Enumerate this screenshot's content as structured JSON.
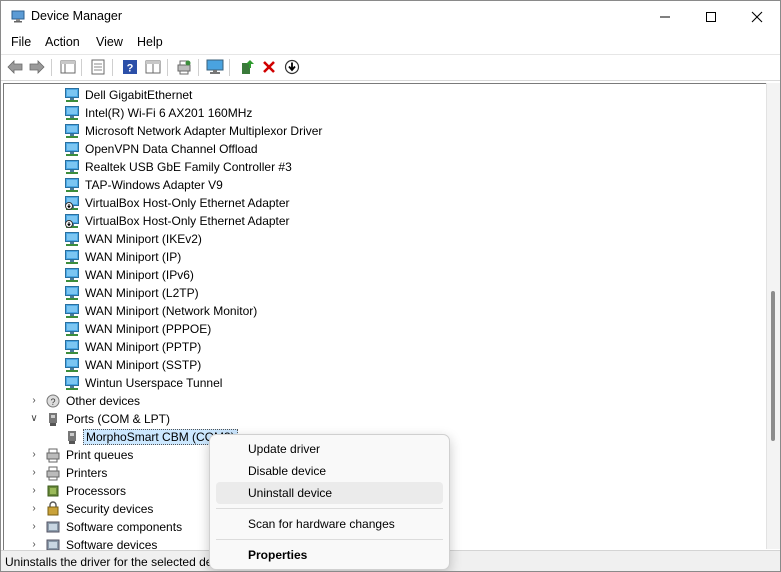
{
  "window": {
    "title": "Device Manager"
  },
  "menubar": {
    "file": "File",
    "action": "Action",
    "view": "View",
    "help": "Help"
  },
  "tree": {
    "network_adapters": [
      "Dell GigabitEthernet",
      "Intel(R) Wi-Fi 6 AX201 160MHz",
      "Microsoft Network Adapter Multiplexor Driver",
      "OpenVPN Data Channel Offload",
      "Realtek USB GbE Family Controller #3",
      "TAP-Windows Adapter V9",
      "VirtualBox Host-Only Ethernet Adapter",
      "VirtualBox Host-Only Ethernet Adapter",
      "WAN Miniport (IKEv2)",
      "WAN Miniport (IP)",
      "WAN Miniport (IPv6)",
      "WAN Miniport (L2TP)",
      "WAN Miniport (Network Monitor)",
      "WAN Miniport (PPPOE)",
      "WAN Miniport (PPTP)",
      "WAN Miniport (SSTP)",
      "Wintun Userspace Tunnel"
    ],
    "other_devices": "Other devices",
    "ports": "Ports (COM & LPT)",
    "ports_child": "MorphoSmart CBM (COM3)",
    "print_queues": "Print queues",
    "printers": "Printers",
    "processors": "Processors",
    "security_devices": "Security devices",
    "software_components": "Software components",
    "software_devices": "Software devices"
  },
  "context_menu": {
    "update_driver": "Update driver",
    "disable_device": "Disable device",
    "uninstall_device": "Uninstall device",
    "scan_hardware": "Scan for hardware changes",
    "properties": "Properties"
  },
  "statusbar": {
    "text": "Uninstalls the driver for the selected device."
  },
  "colors": {
    "selection": "#cce8ff",
    "accent": "#0078d4",
    "delete_red": "#d00000"
  }
}
